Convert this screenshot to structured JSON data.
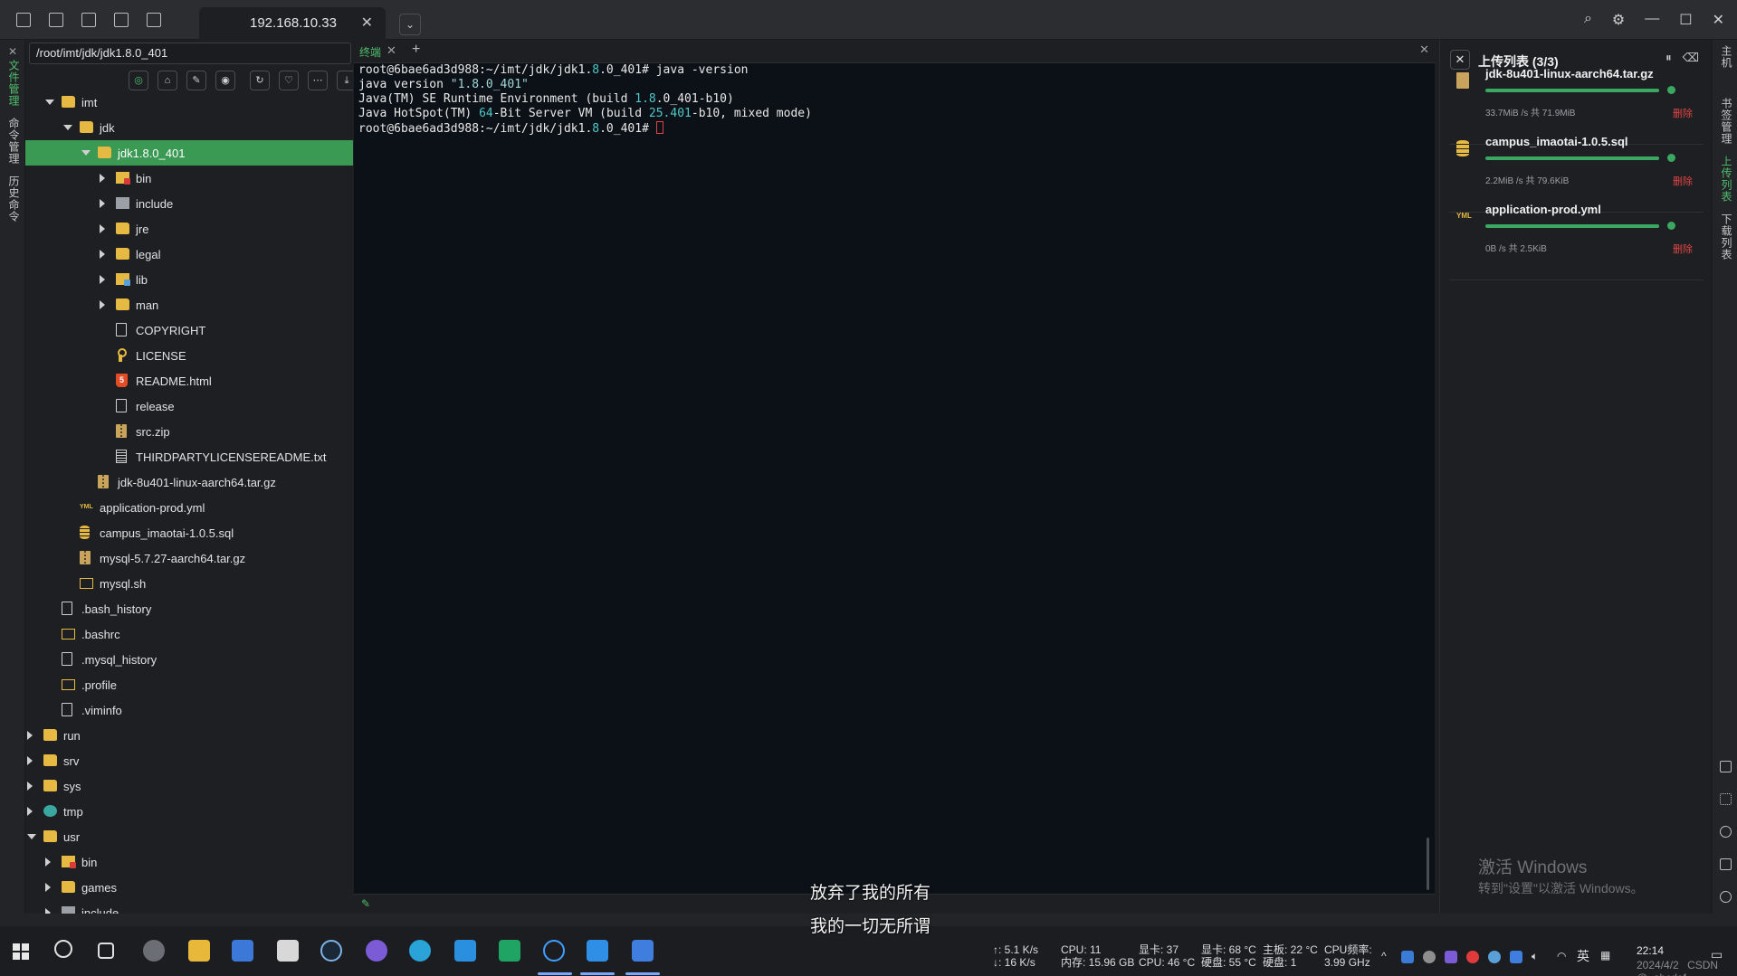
{
  "topbar": {
    "tab_title": "192.168.10.33",
    "tab_close": "✕",
    "dropdown": "⌄"
  },
  "left_rail": {
    "close": "✕",
    "tabs": [
      "文件管理",
      "命令管理",
      "历史命令"
    ]
  },
  "file_panel": {
    "path": "/root/imt/jdk/jdk1.8.0_401",
    "tree": [
      {
        "label": "imt",
        "depth": 1,
        "arrow": "down",
        "icon": "folder"
      },
      {
        "label": "jdk",
        "depth": 2,
        "arrow": "down",
        "icon": "folder"
      },
      {
        "label": "jdk1.8.0_401",
        "depth": 3,
        "arrow": "down",
        "icon": "folder",
        "selected": true
      },
      {
        "label": "bin",
        "depth": 4,
        "arrow": "right",
        "icon": "folder-red"
      },
      {
        "label": "include",
        "depth": 4,
        "arrow": "right",
        "icon": "folder-gray"
      },
      {
        "label": "jre",
        "depth": 4,
        "arrow": "right",
        "icon": "folder"
      },
      {
        "label": "legal",
        "depth": 4,
        "arrow": "right",
        "icon": "folder"
      },
      {
        "label": "lib",
        "depth": 4,
        "arrow": "right",
        "icon": "folder-blue"
      },
      {
        "label": "man",
        "depth": 4,
        "arrow": "right",
        "icon": "folder"
      },
      {
        "label": "COPYRIGHT",
        "depth": 4,
        "arrow": "",
        "icon": "file"
      },
      {
        "label": "LICENSE",
        "depth": 4,
        "arrow": "",
        "icon": "license"
      },
      {
        "label": "README.html",
        "depth": 4,
        "arrow": "",
        "icon": "html"
      },
      {
        "label": "release",
        "depth": 4,
        "arrow": "",
        "icon": "file"
      },
      {
        "label": "src.zip",
        "depth": 4,
        "arrow": "",
        "icon": "zip"
      },
      {
        "label": "THIRDPARTYLICENSEREADME.txt",
        "depth": 4,
        "arrow": "",
        "icon": "file-txt"
      },
      {
        "label": "jdk-8u401-linux-aarch64.tar.gz",
        "depth": 3,
        "arrow": "",
        "icon": "zip"
      },
      {
        "label": "application-prod.yml",
        "depth": 2,
        "arrow": "",
        "icon": "yml"
      },
      {
        "label": "campus_imaotai-1.0.5.sql",
        "depth": 2,
        "arrow": "",
        "icon": "sql"
      },
      {
        "label": "mysql-5.7.27-aarch64.tar.gz",
        "depth": 2,
        "arrow": "",
        "icon": "zip"
      },
      {
        "label": "mysql.sh",
        "depth": 2,
        "arrow": "",
        "icon": "sh"
      },
      {
        "label": ".bash_history",
        "depth": 1,
        "arrow": "",
        "icon": "file"
      },
      {
        "label": ".bashrc",
        "depth": 1,
        "arrow": "",
        "icon": "sh"
      },
      {
        "label": ".mysql_history",
        "depth": 1,
        "arrow": "",
        "icon": "file"
      },
      {
        "label": ".profile",
        "depth": 1,
        "arrow": "",
        "icon": "sh"
      },
      {
        "label": ".viminfo",
        "depth": 1,
        "arrow": "",
        "icon": "file"
      },
      {
        "label": "run",
        "depth": 0,
        "arrow": "right",
        "icon": "folder"
      },
      {
        "label": "srv",
        "depth": 0,
        "arrow": "right",
        "icon": "folder"
      },
      {
        "label": "sys",
        "depth": 0,
        "arrow": "right",
        "icon": "folder"
      },
      {
        "label": "tmp",
        "depth": 0,
        "arrow": "right",
        "icon": "folder-teal"
      },
      {
        "label": "usr",
        "depth": 0,
        "arrow": "down",
        "icon": "folder"
      },
      {
        "label": "bin",
        "depth": 1,
        "arrow": "right",
        "icon": "folder-red"
      },
      {
        "label": "games",
        "depth": 1,
        "arrow": "right",
        "icon": "folder"
      },
      {
        "label": "include",
        "depth": 1,
        "arrow": "right",
        "icon": "folder-gray"
      }
    ]
  },
  "terminal": {
    "tab_label": "终端",
    "tab_close": "✕",
    "add": "+",
    "close": "✕",
    "lines": [
      [
        {
          "t": "root@6bae6ad3d988:~/imt/jdk/jdk1."
        },
        {
          "t": "8",
          "c": "num"
        },
        {
          "t": ".0_401# java -version"
        }
      ],
      [
        {
          "t": "java version "
        },
        {
          "t": "\"1.8.0_401\"",
          "c": "str"
        }
      ],
      [
        {
          "t": "Java(TM) SE Runtime Environment (build "
        },
        {
          "t": "1.8",
          "c": "num"
        },
        {
          "t": ".0_401-b10)"
        }
      ],
      [
        {
          "t": "Java HotSpot(TM) "
        },
        {
          "t": "64",
          "c": "num"
        },
        {
          "t": "-Bit Server VM (build "
        },
        {
          "t": "25.401",
          "c": "num"
        },
        {
          "t": "-b10, mixed mode)"
        }
      ],
      [
        {
          "t": "root@6bae6ad3d988:~/imt/jdk/jdk1."
        },
        {
          "t": "8",
          "c": "num"
        },
        {
          "t": ".0_401# "
        },
        {
          "t": "",
          "c": "cursor"
        }
      ]
    ]
  },
  "subtitles": [
    "放弃了我的所有",
    "我的一切无所谓"
  ],
  "upload_panel": {
    "close": "✕",
    "title": "上传列表 (3/3)",
    "items": [
      {
        "name": "jdk-8u401-linux-aarch64.tar.gz",
        "meta": "33.7MiB /s  共 71.9MiB",
        "delete": "删除",
        "icon": "zip",
        "progress": 1.0
      },
      {
        "name": "campus_imaotai-1.0.5.sql",
        "meta": "2.2MiB /s  共 79.6KiB",
        "delete": "删除",
        "icon": "sql",
        "progress": 1.0
      },
      {
        "name": "application-prod.yml",
        "meta": "0B /s  共 2.5KiB",
        "delete": "删除",
        "icon": "yml",
        "progress": 1.0
      }
    ],
    "activate_title": "激活 Windows",
    "activate_sub": "转到\"设置\"以激活 Windows。"
  },
  "right_rail": {
    "tabs": [
      "主机",
      "书签管理",
      "上传列表",
      "下载列表"
    ]
  },
  "taskbar": {
    "net_up": "↑: 5.1 K/s",
    "net_down": "↓: 16 K/s",
    "cpu": "CPU: 11",
    "mem": "内存: 15.96 GB",
    "gpu_usage": "显卡: 37",
    "cpu_temp": "CPU: 46 °C",
    "gpu_temp": "显卡: 68 °C",
    "disk_temp": "硬盘: 55 °C",
    "board_temp": "主板: 22 °C",
    "disk": "硬盘: 1",
    "cpu_freq_label": "CPU频率:",
    "cpu_freq": "3.99 GHz",
    "ime": "英",
    "time": "22:14",
    "date": "2024/4/2",
    "watermark": "CSDN @_abcdef"
  },
  "colors": {
    "accent_green": "#3a9a53",
    "delete_red": "#e04545",
    "terminal_bg": "#0c1117"
  }
}
